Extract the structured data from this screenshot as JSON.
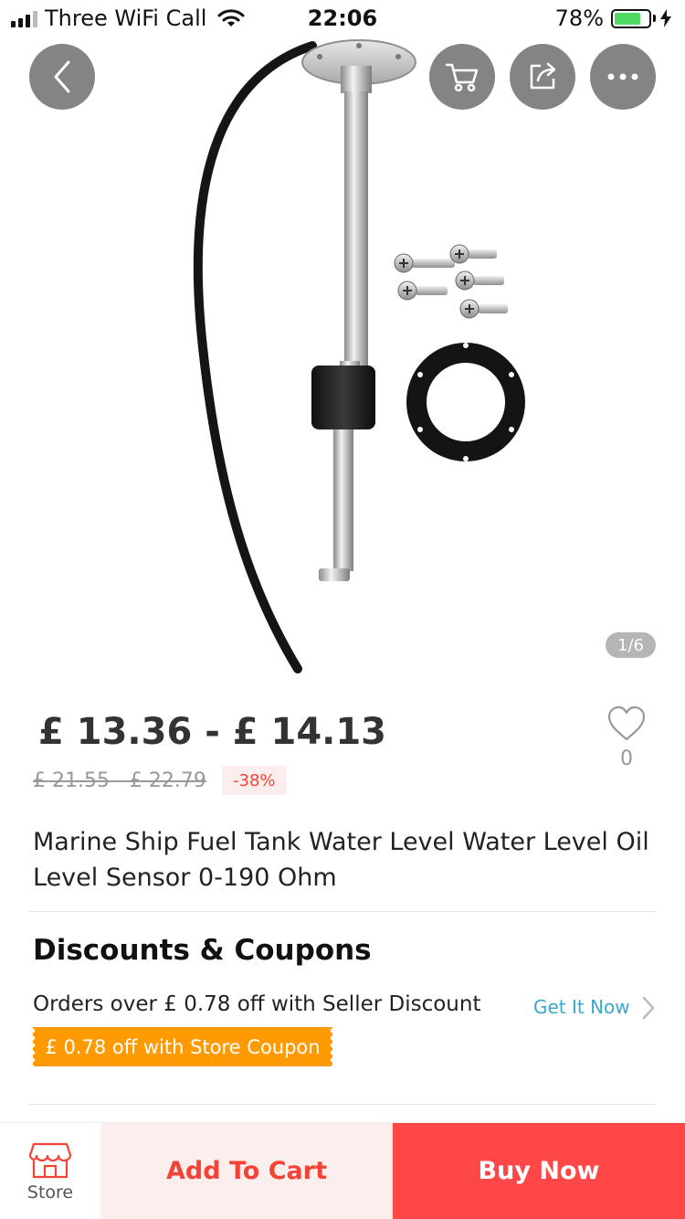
{
  "status_bar": {
    "carrier": "Three WiFi Call",
    "time": "22:06",
    "battery_pct": "78%",
    "battery_level": 0.78
  },
  "gallery": {
    "pager": "1/6",
    "icons": [
      "back-icon",
      "cart-icon",
      "share-icon",
      "more-icon"
    ]
  },
  "product": {
    "price_range": "£ 13.36 - £ 14.13",
    "old_price_range": "£ 21.55 - £ 22.79",
    "discount": "-38%",
    "wishlist_count": "0",
    "title": "Marine Ship Fuel Tank Water Level Water Level Oil Level Sensor 0-190 Ohm"
  },
  "discounts": {
    "heading": "Discounts & Coupons",
    "seller_discount": "Orders over  £ 0.78 off with Seller Discount",
    "get_it_now": "Get It Now",
    "store_coupon": "£ 0.78 off with Store Coupon"
  },
  "bottom_bar": {
    "store_label": "Store",
    "add_to_cart": "Add To Cart",
    "buy_now": "Buy Now"
  },
  "colors": {
    "accent_red": "#ff4747",
    "light_red": "#fdeeee",
    "coupon_orange": "#ff9a00",
    "link_blue": "#3aa8c9"
  }
}
